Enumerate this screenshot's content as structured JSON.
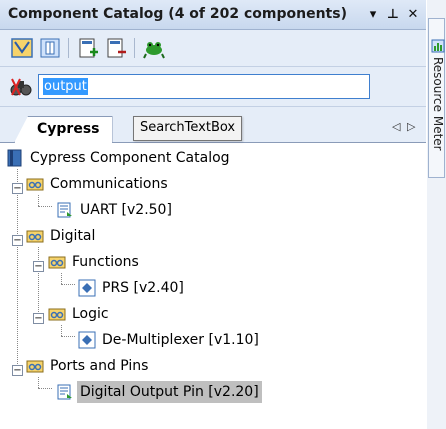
{
  "window": {
    "title": "Component Catalog (4 of 202 components)",
    "dropdown_glyph": "▾",
    "pin_glyph": "⊥",
    "close_glyph": "✕"
  },
  "toolbar": {
    "items": [
      "catalog-view-icon",
      "book-icon",
      "add-component-icon",
      "remove-component-icon",
      "frog-icon"
    ]
  },
  "search": {
    "value": "output",
    "tooltip": "SearchTextBox"
  },
  "tabs": {
    "active": "Cypress",
    "prev_glyph": "◁",
    "next_glyph": "▷"
  },
  "tree": {
    "root": "Cypress Component Catalog",
    "n_communications": "Communications",
    "n_uart": "UART [v2.50]",
    "n_digital": "Digital",
    "n_functions": "Functions",
    "n_prs": "PRS [v2.40]",
    "n_logic": "Logic",
    "n_demux": "De-Multiplexer [v1.10]",
    "n_ports": "Ports and Pins",
    "n_dop": "Digital Output Pin [v2.20]"
  },
  "side_panel": {
    "label": "Resource Meter"
  },
  "colors": {
    "accent": "#3399ff",
    "title_bg": "#c8d8ee",
    "selected": "#bfbfbf"
  }
}
